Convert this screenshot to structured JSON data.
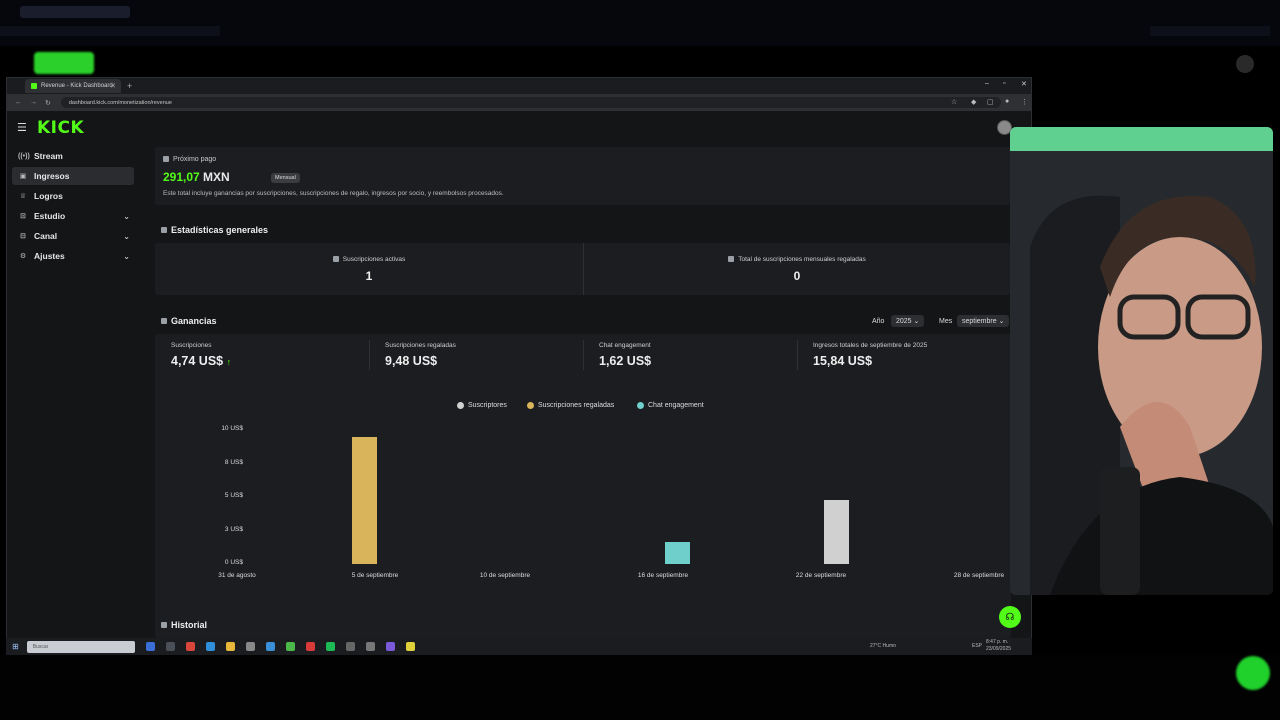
{
  "browser": {
    "tab_title": "Revenue - Kick Dashboard",
    "url": "dashboard.kick.com/monetization/revenue"
  },
  "brand": {
    "logo_text": "KICK",
    "accent": "#53fc18"
  },
  "sidebar": {
    "items": [
      {
        "label": "Stream",
        "icon": "broadcast-icon",
        "active": false,
        "expandable": false
      },
      {
        "label": "Ingresos",
        "icon": "revenue-icon",
        "active": true,
        "expandable": false
      },
      {
        "label": "Logros",
        "icon": "trophy-icon",
        "active": false,
        "expandable": false
      },
      {
        "label": "Estudio",
        "icon": "studio-icon",
        "active": false,
        "expandable": true
      },
      {
        "label": "Canal",
        "icon": "channel-icon",
        "active": false,
        "expandable": true
      },
      {
        "label": "Ajustes",
        "icon": "gear-icon",
        "active": false,
        "expandable": true
      }
    ]
  },
  "next_payment": {
    "label": "Próximo pago",
    "amount": "291,07 MXN",
    "currency": "MXN",
    "badge": "Mensual",
    "description": "Este total incluye ganancias por suscripciones, suscripciones de regalo, ingresos por socio, y reembolsos procesados."
  },
  "general_stats": {
    "title": "Estadísticas generales",
    "items": [
      {
        "label": "Suscripciones activas",
        "value": "1"
      },
      {
        "label": "Total de suscripciones mensuales regaladas",
        "value": "0"
      }
    ]
  },
  "earnings": {
    "title": "Ganancias",
    "year_label": "Año",
    "year_value": "2025",
    "month_label": "Mes",
    "month_value": "septiembre",
    "cards": [
      {
        "label": "Suscripciones",
        "value": "4,74 US$",
        "trend_up": true
      },
      {
        "label": "Suscripciones regaladas",
        "value": "9,48 US$"
      },
      {
        "label": "Chat engagement",
        "value": "1,62 US$"
      },
      {
        "label": "Ingresos totales de septiembre de 2025",
        "value": "15,84 US$"
      }
    ]
  },
  "chart_data": {
    "type": "bar",
    "legend": [
      {
        "name": "Suscriptores",
        "color": "#d0d0d0"
      },
      {
        "name": "Suscripciones regaladas",
        "color": "#d9b45a"
      },
      {
        "name": "Chat engagement",
        "color": "#6fcfcb"
      }
    ],
    "y_ticks": [
      "10 US$",
      "8 US$",
      "5 US$",
      "3 US$",
      "0 US$"
    ],
    "ylim": [
      0,
      10
    ],
    "x_ticks": [
      "31 de agosto",
      "5 de septiembre",
      "10 de septiembre",
      "16 de septiembre",
      "22 de septiembre",
      "28 de septiembre"
    ],
    "x_range_days": [
      0,
      28
    ],
    "bars": [
      {
        "series": "Suscripciones regaladas",
        "day_offset": 4.8,
        "value": 9.48,
        "color": "#d9b45a"
      },
      {
        "series": "Chat engagement",
        "day_offset": 16.6,
        "value": 1.62,
        "color": "#6fcfcb"
      },
      {
        "series": "Suscriptores",
        "day_offset": 22.6,
        "value": 4.74,
        "color": "#d0d0d0"
      }
    ]
  },
  "history": {
    "title": "Historial"
  },
  "taskbar": {
    "search_placeholder": "Buscar",
    "weather": "27°C Humo",
    "clock_time": "8:47 p. m.",
    "clock_date": "23/09/2025",
    "lang": "ESP"
  }
}
